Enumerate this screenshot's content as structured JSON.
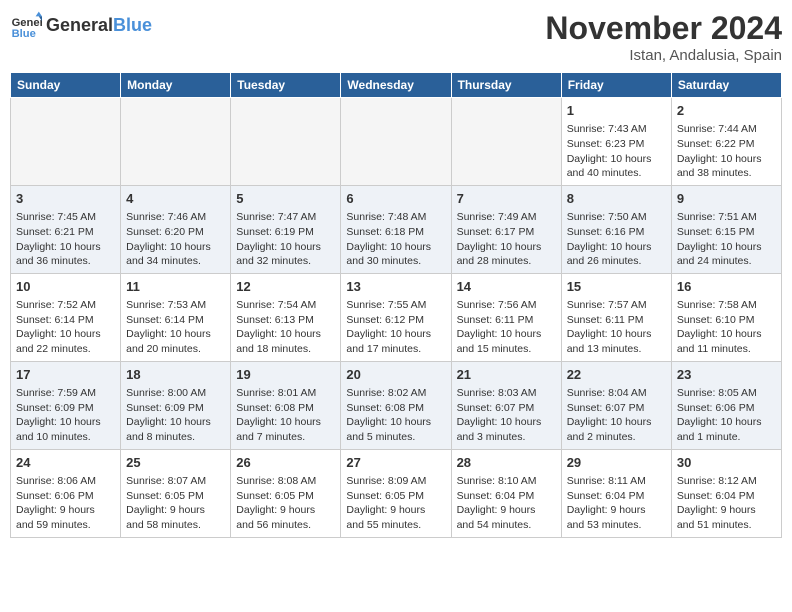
{
  "header": {
    "logo_text_general": "General",
    "logo_text_blue": "Blue",
    "month_title": "November 2024",
    "subtitle": "Istan, Andalusia, Spain"
  },
  "weekdays": [
    "Sunday",
    "Monday",
    "Tuesday",
    "Wednesday",
    "Thursday",
    "Friday",
    "Saturday"
  ],
  "weeks": [
    [
      {
        "day": "",
        "info": ""
      },
      {
        "day": "",
        "info": ""
      },
      {
        "day": "",
        "info": ""
      },
      {
        "day": "",
        "info": ""
      },
      {
        "day": "",
        "info": ""
      },
      {
        "day": "1",
        "info": "Sunrise: 7:43 AM\nSunset: 6:23 PM\nDaylight: 10 hours and 40 minutes."
      },
      {
        "day": "2",
        "info": "Sunrise: 7:44 AM\nSunset: 6:22 PM\nDaylight: 10 hours and 38 minutes."
      }
    ],
    [
      {
        "day": "3",
        "info": "Sunrise: 7:45 AM\nSunset: 6:21 PM\nDaylight: 10 hours and 36 minutes."
      },
      {
        "day": "4",
        "info": "Sunrise: 7:46 AM\nSunset: 6:20 PM\nDaylight: 10 hours and 34 minutes."
      },
      {
        "day": "5",
        "info": "Sunrise: 7:47 AM\nSunset: 6:19 PM\nDaylight: 10 hours and 32 minutes."
      },
      {
        "day": "6",
        "info": "Sunrise: 7:48 AM\nSunset: 6:18 PM\nDaylight: 10 hours and 30 minutes."
      },
      {
        "day": "7",
        "info": "Sunrise: 7:49 AM\nSunset: 6:17 PM\nDaylight: 10 hours and 28 minutes."
      },
      {
        "day": "8",
        "info": "Sunrise: 7:50 AM\nSunset: 6:16 PM\nDaylight: 10 hours and 26 minutes."
      },
      {
        "day": "9",
        "info": "Sunrise: 7:51 AM\nSunset: 6:15 PM\nDaylight: 10 hours and 24 minutes."
      }
    ],
    [
      {
        "day": "10",
        "info": "Sunrise: 7:52 AM\nSunset: 6:14 PM\nDaylight: 10 hours and 22 minutes."
      },
      {
        "day": "11",
        "info": "Sunrise: 7:53 AM\nSunset: 6:14 PM\nDaylight: 10 hours and 20 minutes."
      },
      {
        "day": "12",
        "info": "Sunrise: 7:54 AM\nSunset: 6:13 PM\nDaylight: 10 hours and 18 minutes."
      },
      {
        "day": "13",
        "info": "Sunrise: 7:55 AM\nSunset: 6:12 PM\nDaylight: 10 hours and 17 minutes."
      },
      {
        "day": "14",
        "info": "Sunrise: 7:56 AM\nSunset: 6:11 PM\nDaylight: 10 hours and 15 minutes."
      },
      {
        "day": "15",
        "info": "Sunrise: 7:57 AM\nSunset: 6:11 PM\nDaylight: 10 hours and 13 minutes."
      },
      {
        "day": "16",
        "info": "Sunrise: 7:58 AM\nSunset: 6:10 PM\nDaylight: 10 hours and 11 minutes."
      }
    ],
    [
      {
        "day": "17",
        "info": "Sunrise: 7:59 AM\nSunset: 6:09 PM\nDaylight: 10 hours and 10 minutes."
      },
      {
        "day": "18",
        "info": "Sunrise: 8:00 AM\nSunset: 6:09 PM\nDaylight: 10 hours and 8 minutes."
      },
      {
        "day": "19",
        "info": "Sunrise: 8:01 AM\nSunset: 6:08 PM\nDaylight: 10 hours and 7 minutes."
      },
      {
        "day": "20",
        "info": "Sunrise: 8:02 AM\nSunset: 6:08 PM\nDaylight: 10 hours and 5 minutes."
      },
      {
        "day": "21",
        "info": "Sunrise: 8:03 AM\nSunset: 6:07 PM\nDaylight: 10 hours and 3 minutes."
      },
      {
        "day": "22",
        "info": "Sunrise: 8:04 AM\nSunset: 6:07 PM\nDaylight: 10 hours and 2 minutes."
      },
      {
        "day": "23",
        "info": "Sunrise: 8:05 AM\nSunset: 6:06 PM\nDaylight: 10 hours and 1 minute."
      }
    ],
    [
      {
        "day": "24",
        "info": "Sunrise: 8:06 AM\nSunset: 6:06 PM\nDaylight: 9 hours and 59 minutes."
      },
      {
        "day": "25",
        "info": "Sunrise: 8:07 AM\nSunset: 6:05 PM\nDaylight: 9 hours and 58 minutes."
      },
      {
        "day": "26",
        "info": "Sunrise: 8:08 AM\nSunset: 6:05 PM\nDaylight: 9 hours and 56 minutes."
      },
      {
        "day": "27",
        "info": "Sunrise: 8:09 AM\nSunset: 6:05 PM\nDaylight: 9 hours and 55 minutes."
      },
      {
        "day": "28",
        "info": "Sunrise: 8:10 AM\nSunset: 6:04 PM\nDaylight: 9 hours and 54 minutes."
      },
      {
        "day": "29",
        "info": "Sunrise: 8:11 AM\nSunset: 6:04 PM\nDaylight: 9 hours and 53 minutes."
      },
      {
        "day": "30",
        "info": "Sunrise: 8:12 AM\nSunset: 6:04 PM\nDaylight: 9 hours and 51 minutes."
      }
    ]
  ]
}
